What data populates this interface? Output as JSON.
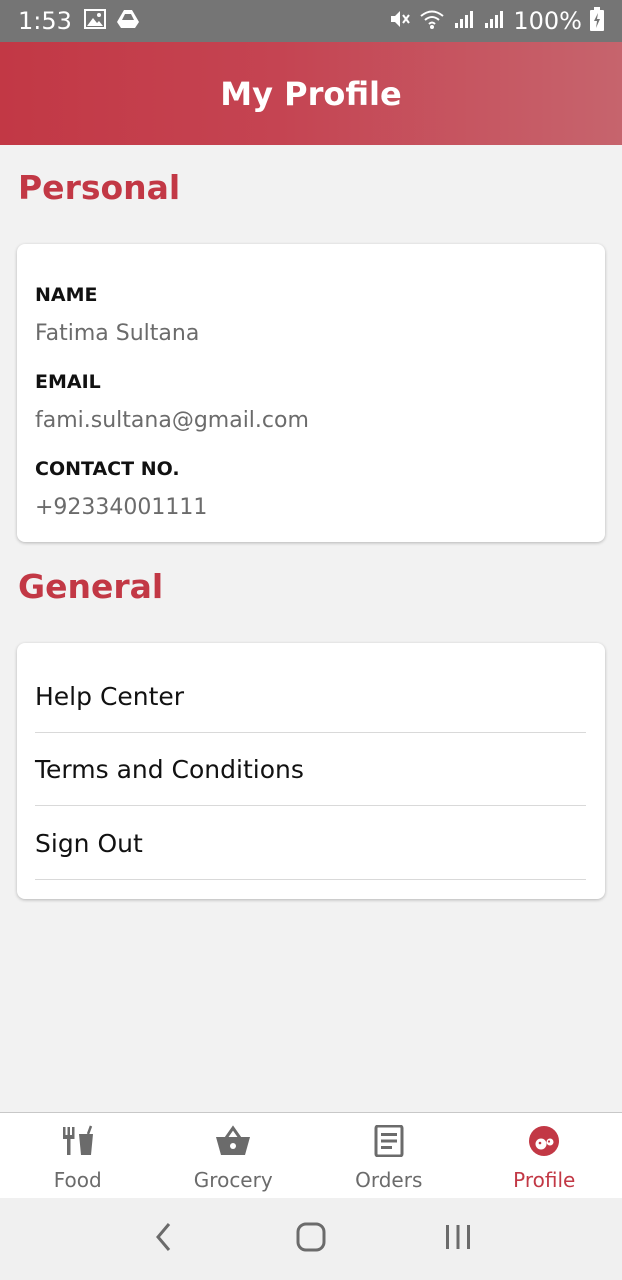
{
  "status_bar": {
    "time": "1:53",
    "battery": "100%",
    "left_icons": [
      "image-icon",
      "drive-icon"
    ],
    "right_icons": [
      "mute-icon",
      "wifi-icon",
      "signal-icon",
      "signal-icon",
      "battery-charging-icon"
    ]
  },
  "header": {
    "title": "My Profile"
  },
  "personal": {
    "heading": "Personal",
    "fields": [
      {
        "label": "NAME",
        "value": "Fatima Sultana"
      },
      {
        "label": "EMAIL",
        "value": "fami.sultana@gmail.com"
      },
      {
        "label": "CONTACT NO.",
        "value": "+92334001111"
      }
    ]
  },
  "general": {
    "heading": "General",
    "items": [
      {
        "label": "Help Center"
      },
      {
        "label": "Terms and Conditions"
      },
      {
        "label": "Sign Out"
      }
    ]
  },
  "bottom_nav": {
    "active_index": 3,
    "items": [
      {
        "label": "Food",
        "icon": "fork-cup-icon"
      },
      {
        "label": "Grocery",
        "icon": "basket-icon"
      },
      {
        "label": "Orders",
        "icon": "receipt-icon"
      },
      {
        "label": "Profile",
        "icon": "profile-face-icon"
      }
    ]
  },
  "colors": {
    "accent": "#c23845",
    "status_bar": "#757575",
    "background": "#f2f2f2",
    "inactive_nav": "#6b6b6b"
  }
}
